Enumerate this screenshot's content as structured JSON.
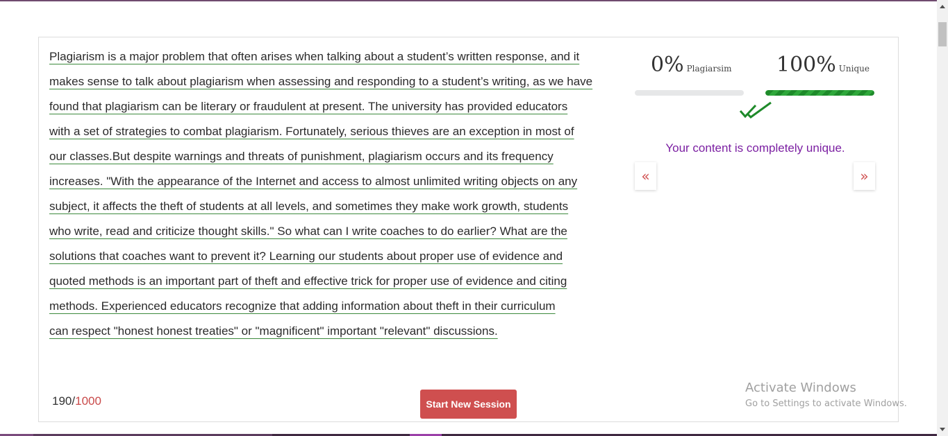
{
  "editor": {
    "text_lines": [
      "Plagiarism is a major problem that often arises when talking about a student’s written response, and it",
      "makes sense to talk about plagiarism when assessing and responding to a student’s writing, as we have",
      "found that plagiarism can be literary or fraudulent at present. The university has provided educators",
      "with a set of strategies to combat plagiarism. Fortunately, serious thieves are an exception in most of",
      "our classes.But despite warnings and threats of punishment, plagiarism occurs and its frequency",
      "increases. \"With the appearance of the Internet and access to almost unlimited writing objects on any",
      "subject, it affects the theft of students at all levels, and sometimes they make work growth, students",
      "who write, read and criticize thought skills.\" So what can I write coaches to do earlier? What are the",
      "solutions that coaches want to prevent it? Learning our students about proper use of evidence and",
      "quoted methods is an important part of theft and effective trick for proper use of evidence and citing",
      "methods. Experienced educators recognize that adding information about theft in their curriculum",
      "can respect \"honest honest treaties\" or \"magnificent\" important \"relevant\" discussions."
    ],
    "word_count": "190",
    "word_separator": "/",
    "word_limit": "1000"
  },
  "actions": {
    "start_new_session": "Start New Session"
  },
  "results": {
    "plagiarism_percent": "0%",
    "plagiarism_label": "Plagiarsim",
    "plagiarism_fraction": 0,
    "unique_percent": "100%",
    "unique_label": "Unique",
    "unique_fraction": 1,
    "message": "Your content is completely unique.",
    "check_icon": "double-check-icon",
    "prev_icon": "double-chevron-left-icon",
    "next_icon": "double-chevron-right-icon",
    "prev_glyph": "«",
    "next_glyph": "»"
  },
  "watermark": {
    "line1": "Activate Windows",
    "line2": "Go to Settings to activate Windows."
  },
  "colors": {
    "accent_red": "#cf4f4f",
    "unique_green": "#1e8a2a",
    "message_purple": "#7b1fa2",
    "top_border": "#6f4a6e"
  }
}
